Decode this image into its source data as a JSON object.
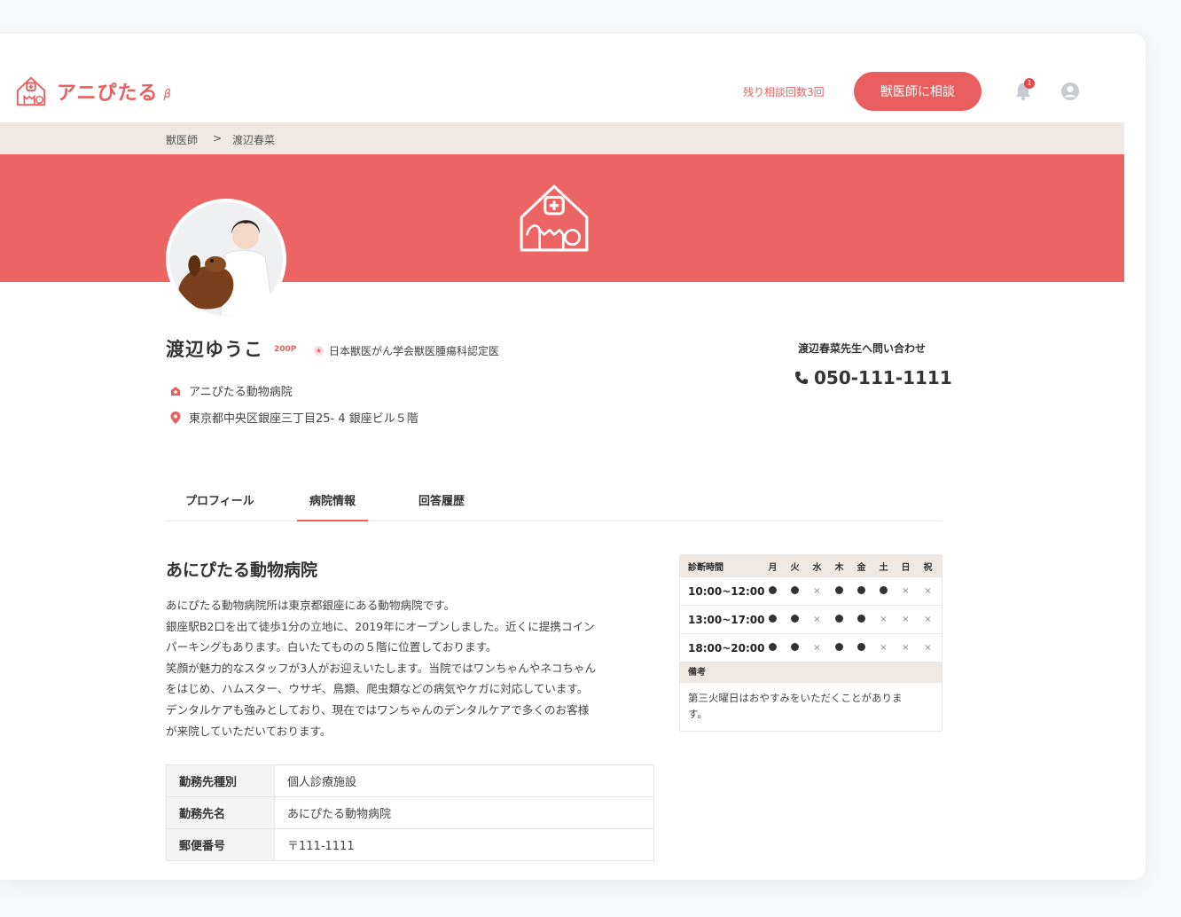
{
  "app": {
    "name": "アニぴたる",
    "beta": "β"
  },
  "header": {
    "remaining": "残り相談回数3回",
    "consult_button": "獣医師に相談",
    "notification_count": "1"
  },
  "breadcrumb": {
    "items": [
      "獣医師",
      ">",
      "渡辺春菜"
    ]
  },
  "profile": {
    "name": "渡辺ゆうこ",
    "points": "200P",
    "certification": "日本獣医がん学会獣医腫瘍科認定医",
    "clinic": "アニぴたる動物病院",
    "address": "東京都中央区銀座三丁目25- 4 銀座ビル５階"
  },
  "contact": {
    "label": "渡辺春菜先生へ問い合わせ",
    "phone": "050-111-1111"
  },
  "tabs": [
    {
      "label": "プロフィール",
      "active": false
    },
    {
      "label": "病院情報",
      "active": true
    },
    {
      "label": "回答履歴",
      "active": false
    }
  ],
  "clinic_info": {
    "title": "あにぴたる動物病院",
    "description": [
      "あにぴたる動物病院所は東京都銀座にある動物病院です。",
      "銀座駅B2口を出て徒歩1分の立地に、2019年にオープンしました。近くに提携コイン",
      "パーキングもあります。白いたてものの５階に位置しております。",
      "笑顔が魅力的なスタッフが3人がお迎えいたします。当院ではワンちゃんやネコちゃん",
      "をはじめ、ハムスター、ウサギ、鳥類、爬虫類などの病気やケガに対応しています。",
      "デンタルケアも強みとしており、現在ではワンちゃんのデンタルケアで多くのお客様",
      "が来院していただいております。"
    ],
    "table": [
      {
        "key": "勤務先種別",
        "value": "個人診療施設"
      },
      {
        "key": "勤務先名",
        "value": "あにぴたる動物病院"
      },
      {
        "key": "郵便番号",
        "value": "〒111-1111"
      }
    ]
  },
  "hours": {
    "header_label": "診断時間",
    "days": [
      "月",
      "火",
      "水",
      "木",
      "金",
      "土",
      "日",
      "祝"
    ],
    "rows": [
      {
        "time": "10:00~12:00",
        "open": [
          true,
          true,
          false,
          true,
          true,
          true,
          false,
          false
        ]
      },
      {
        "time": "13:00~17:00",
        "open": [
          true,
          true,
          false,
          true,
          true,
          false,
          false,
          false
        ]
      },
      {
        "time": "18:00~20:00",
        "open": [
          true,
          true,
          false,
          true,
          true,
          false,
          false,
          false
        ]
      }
    ],
    "closed_mark": "×",
    "notes_label": "備考",
    "notes": [
      "第三火曜日はおやすみをいただくことがありま",
      "す。"
    ]
  },
  "colors": {
    "accent": "#e95f5f",
    "banner": "#ec6464",
    "breadcrumb_bg": "#efe8e3"
  }
}
